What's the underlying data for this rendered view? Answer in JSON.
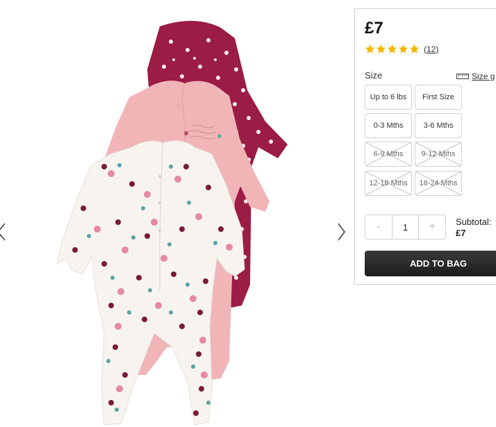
{
  "gallery": {
    "image_icon": "baby-sleepsuits-product-image",
    "prev_icon": "chevron-left-icon",
    "next_icon": "chevron-right-icon"
  },
  "product": {
    "price": "£7",
    "rating": 5,
    "review_count": "(12)",
    "star_color": "#f5b800"
  },
  "size": {
    "label": "Size",
    "guide_label": "Size g",
    "guide_icon": "ruler-icon",
    "options": [
      {
        "label": "Up to 6 lbs",
        "available": true
      },
      {
        "label": "First Size",
        "available": true
      },
      {
        "label": "0-3 Mths",
        "available": true
      },
      {
        "label": "3-6 Mths",
        "available": true
      },
      {
        "label": "6-9 Mths",
        "available": false
      },
      {
        "label": "9-12 Mths",
        "available": false
      },
      {
        "label": "12-18 Mths",
        "available": false
      },
      {
        "label": "18-24 Mths",
        "available": false
      }
    ]
  },
  "quantity": {
    "minus": "-",
    "value": "1",
    "plus": "+"
  },
  "subtotal": {
    "label": "Subtotal:",
    "amount": "£7"
  },
  "actions": {
    "add_to_bag": "ADD TO BAG"
  },
  "colors": {
    "burgundy": "#9b1c44",
    "pink": "#f1b5b8",
    "cream": "#f7f4ef",
    "button": "#222222"
  }
}
